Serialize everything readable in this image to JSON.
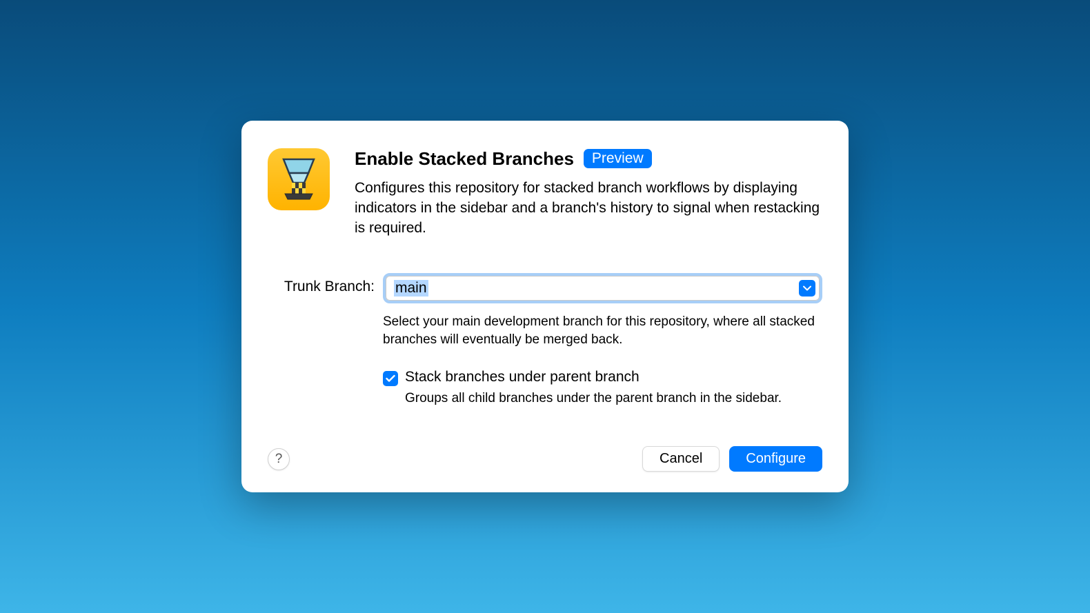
{
  "dialog": {
    "title": "Enable Stacked Branches",
    "badge": "Preview",
    "description": "Configures this repository for stacked branch workflows by displaying indicators in the sidebar and a branch's history to signal when restacking is required."
  },
  "form": {
    "trunk_label": "Trunk Branch:",
    "trunk_value": "main",
    "trunk_help": "Select your main development branch for this repository, where all stacked branches will eventually be merged back.",
    "checkbox": {
      "checked": true,
      "label": "Stack branches under parent branch",
      "description": "Groups all child branches under the parent branch in the sidebar."
    }
  },
  "footer": {
    "help": "?",
    "cancel": "Cancel",
    "configure": "Configure"
  }
}
